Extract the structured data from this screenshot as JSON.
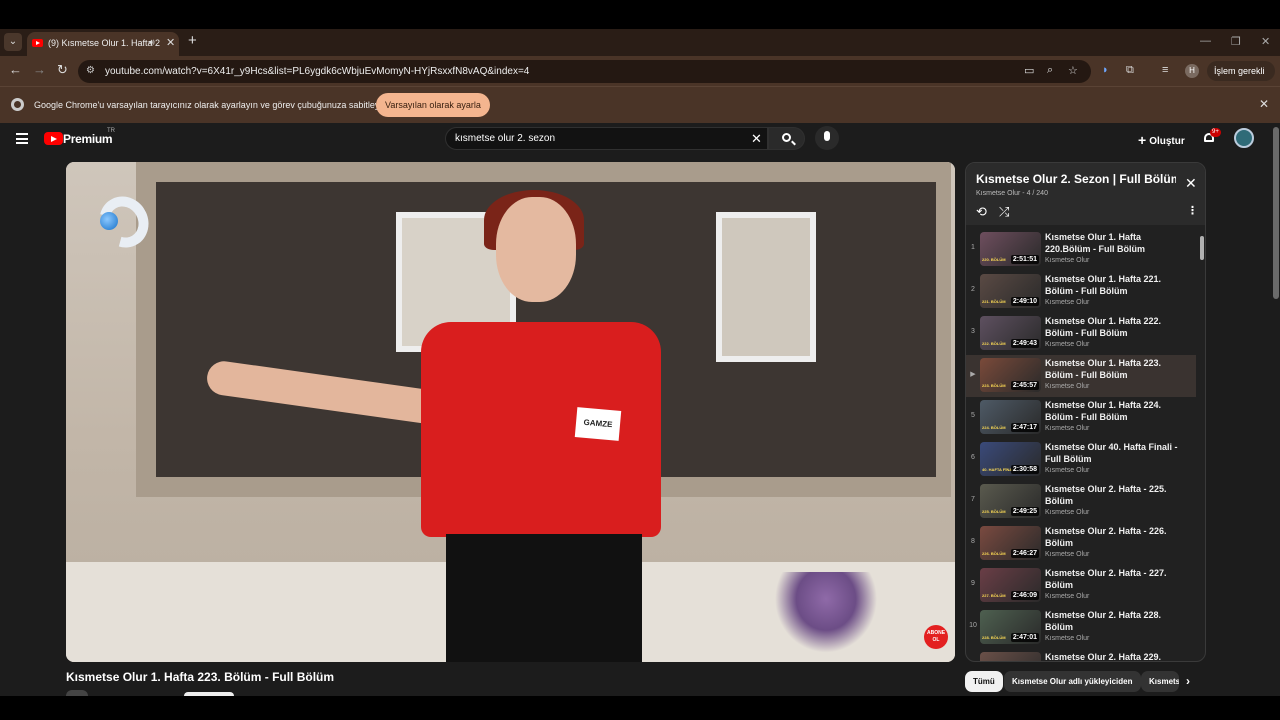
{
  "browser": {
    "tab": {
      "title": "(9) Kısmetse Olur 1. Hafta 2",
      "audio_icon": "speaker-icon"
    },
    "new_tab": "+",
    "url": "youtube.com/watch?v=6X41r_y9Hcs&list=PL6ygdk6cWbjuEvMomyN-HYjRsxxfN8vAQ&index=4",
    "profile_initial": "H",
    "action_button": "İşlem gerekli",
    "infobar": {
      "message": "Google Chrome'u varsayılan tarayıcınız olarak ayarlayın ve görev çubuğunuza sabitleyin",
      "button": "Varsayılan olarak ayarla"
    },
    "colors": {
      "frame": "#4a3427",
      "accent_button": "#f4b58f"
    }
  },
  "youtube": {
    "logo_text": "Premium",
    "logo_region": "TR",
    "search": {
      "value": "kısmetse olur 2. sezon"
    },
    "create_label": "Oluştur",
    "notification_count": "9+",
    "video": {
      "title": "Kısmetse Olur 1. Hafta 223. Bölüm - Full Bölüm",
      "name_badge": "GAMZE",
      "subscribe_overlay": "ABONE OL"
    },
    "playlist": {
      "title": "Kısmetse Olur 2. Sezon | Full Bölüml...",
      "subtitle": "Kısmetse Olur - 4 / 240",
      "items": [
        {
          "index": "1",
          "title": "Kısmetse Olur 1. Hafta 220.Bölüm - Full Bölüm",
          "channel": "Kısmetse Olur",
          "duration": "2:51:51",
          "thumb_label": "220. BÖLÜM",
          "thumb_color": "#6e4e5e"
        },
        {
          "index": "2",
          "title": "Kısmetse Olur 1. Hafta 221. Bölüm - Full Bölüm",
          "channel": "Kısmetse Olur",
          "duration": "2:49:10",
          "thumb_label": "221. BÖLÜM",
          "thumb_color": "#5a4a44"
        },
        {
          "index": "3",
          "title": "Kısmetse Olur 1. Hafta 222. Bölüm - Full Bölüm",
          "channel": "Kısmetse Olur",
          "duration": "2:49:43",
          "thumb_label": "222. BÖLÜM",
          "thumb_color": "#5e5060"
        },
        {
          "index": "▶",
          "title": "Kısmetse Olur 1. Hafta 223. Bölüm - Full Bölüm",
          "channel": "Kısmetse Olur",
          "duration": "2:45:57",
          "thumb_label": "223. BÖLÜM",
          "thumb_color": "#7a4a3a",
          "active": true
        },
        {
          "index": "5",
          "title": "Kısmetse Olur 1. Hafta 224. Bölüm - Full Bölüm",
          "channel": "Kısmetse Olur",
          "duration": "2:47:17",
          "thumb_label": "224. BÖLÜM",
          "thumb_color": "#4e5a66"
        },
        {
          "index": "6",
          "title": "Kısmetse Olur 40. Hafta Finali - Full Bölüm",
          "channel": "Kısmetse Olur",
          "duration": "2:30:58",
          "thumb_label": "40. HAFTA FİNALİ",
          "thumb_color": "#3a4a7a"
        },
        {
          "index": "7",
          "title": "Kısmetse Olur 2. Hafta - 225. Bölüm",
          "channel": "Kısmetse Olur",
          "duration": "2:49:25",
          "thumb_label": "225. BÖLÜM",
          "thumb_color": "#5a5a4e"
        },
        {
          "index": "8",
          "title": "Kısmetse Olur 2. Hafta - 226. Bölüm",
          "channel": "Kısmetse Olur",
          "duration": "2:46:27",
          "thumb_label": "226. BÖLÜM",
          "thumb_color": "#7a4a40"
        },
        {
          "index": "9",
          "title": "Kısmetse Olur 2. Hafta - 227. Bölüm",
          "channel": "Kısmetse Olur",
          "duration": "2:46:09",
          "thumb_label": "227. BÖLÜM",
          "thumb_color": "#6a3e46"
        },
        {
          "index": "10",
          "title": "Kısmetse Olur 2. Hafta 228. Bölüm",
          "channel": "Kısmetse Olur",
          "duration": "2:47:01",
          "thumb_label": "228. BÖLÜM",
          "thumb_color": "#4e6050"
        },
        {
          "index": "",
          "title": "Kısmetse Olur 2. Hafta 229.",
          "channel": "",
          "duration": "",
          "thumb_label": "",
          "thumb_color": "#6a5048"
        }
      ]
    },
    "chips": [
      "Tümü",
      "Kısmetse Olur adlı yükleyiciden",
      "Kısmetse Olur"
    ]
  }
}
